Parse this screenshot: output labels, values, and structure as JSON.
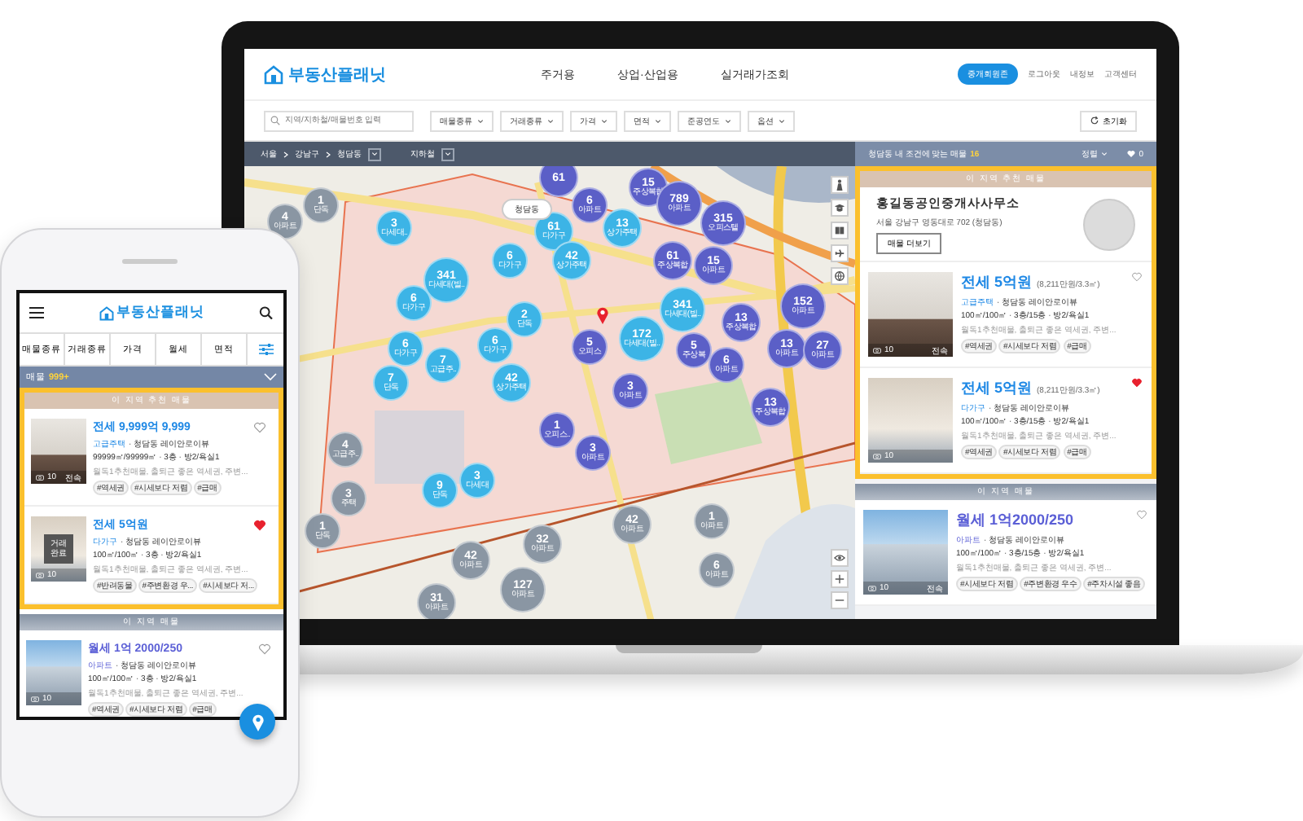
{
  "laptop": {
    "header": {
      "logo": "부동산플래닛",
      "nav": [
        "주거용",
        "상업·산업용",
        "실거래가조회"
      ],
      "member_button": "중개회원존",
      "links": [
        "로그아웃",
        "내정보",
        "고객센터"
      ]
    },
    "filters": {
      "search": {
        "placeholder": "지역/지하철/매물번호 입력"
      },
      "dropdowns": [
        "매물종류",
        "거래종류",
        "가격",
        "면적",
        "준공연도",
        "옵션"
      ],
      "reset_button": "초기화"
    },
    "breadcrumb": {
      "items": [
        "서울",
        "강남구",
        "청담동"
      ],
      "subway": "지하철"
    },
    "map": {
      "area_label": "청담동",
      "clusters": [
        {
          "count": "61",
          "color": "#5b5fc7"
        },
        {
          "count": "15",
          "label": "주상복합",
          "color": "#5b5fc7"
        },
        {
          "count": "4",
          "label": "아파트",
          "color": "#8a96a3"
        },
        {
          "count": "1",
          "label": "단독",
          "color": "#8a96a3"
        },
        {
          "count": "3",
          "label": "다세대..",
          "color": "#3cb4e6"
        },
        {
          "count": "61",
          "label": "다가구",
          "color": "#3cb4e6"
        },
        {
          "count": "6",
          "label": "아파트",
          "color": "#5b5fc7"
        },
        {
          "count": "13",
          "label": "상가주택",
          "color": "#3cb4e6"
        },
        {
          "count": "789",
          "label": "아파트",
          "color": "#5b5fc7"
        },
        {
          "count": "315",
          "label": "오피스텔",
          "color": "#5b5fc7"
        },
        {
          "count": "6",
          "label": "다가구",
          "color": "#3cb4e6"
        },
        {
          "count": "42",
          "label": "상가주택",
          "color": "#3cb4e6"
        },
        {
          "count": "61",
          "label": "주상복합",
          "color": "#5b5fc7"
        },
        {
          "count": "15",
          "label": "아파트",
          "color": "#5b5fc7"
        },
        {
          "count": "6",
          "label": "다가구",
          "color": "#3cb4e6"
        },
        {
          "count": "341",
          "label": "다세대(빌..",
          "color": "#3cb4e6"
        },
        {
          "count": "341",
          "label": "다세대(빌..",
          "color": "#3cb4e6"
        },
        {
          "count": "152",
          "label": "아파트",
          "color": "#5b5fc7"
        },
        {
          "count": "6",
          "label": "다가구",
          "color": "#3cb4e6"
        },
        {
          "count": "7",
          "label": "고급주..",
          "color": "#3cb4e6"
        },
        {
          "count": "6",
          "label": "다가구",
          "color": "#3cb4e6"
        },
        {
          "count": "2",
          "label": "단독",
          "color": "#3cb4e6"
        },
        {
          "count": "5",
          "label": "오피스",
          "color": "#5b5fc7"
        },
        {
          "count": "172",
          "label": "다세대(빌..",
          "color": "#3cb4e6"
        },
        {
          "count": "5",
          "label": "주상복",
          "color": "#5b5fc7"
        },
        {
          "count": "13",
          "label": "주상복합",
          "color": "#5b5fc7"
        },
        {
          "count": "6",
          "label": "아파트",
          "color": "#5b5fc7"
        },
        {
          "count": "13",
          "label": "아파트",
          "color": "#5b5fc7"
        },
        {
          "count": "27",
          "label": "아파트",
          "color": "#5b5fc7"
        },
        {
          "count": "7",
          "label": "단독",
          "color": "#3cb4e6"
        },
        {
          "count": "42",
          "label": "상가주택",
          "color": "#3cb4e6"
        },
        {
          "count": "3",
          "label": "아파트",
          "color": "#5b5fc7"
        },
        {
          "count": "13",
          "label": "주상복합",
          "color": "#5b5fc7"
        },
        {
          "count": "4",
          "label": "고급주..",
          "color": "#8a96a3"
        },
        {
          "count": "1",
          "label": "오피스..",
          "color": "#5b5fc7"
        },
        {
          "count": "3",
          "label": "아파트",
          "color": "#5b5fc7"
        },
        {
          "count": "9",
          "label": "단독",
          "color": "#3cb4e6"
        },
        {
          "count": "3",
          "label": "다세대",
          "color": "#3cb4e6"
        },
        {
          "count": "1",
          "label": "단독",
          "color": "#8a96a3"
        },
        {
          "count": "3",
          "label": "주택",
          "color": "#8a96a3"
        },
        {
          "count": "32",
          "label": "아파트",
          "color": "#8a96a3"
        },
        {
          "count": "42",
          "label": "아파트",
          "color": "#8a96a3"
        },
        {
          "count": "1",
          "label": "아파트",
          "color": "#8a96a3"
        },
        {
          "count": "31",
          "label": "아파트",
          "color": "#8a96a3"
        },
        {
          "count": "42",
          "label": "아파트",
          "color": "#8a96a3"
        },
        {
          "count": "127",
          "label": "아파트",
          "color": "#8a96a3"
        },
        {
          "count": "6",
          "label": "아파트",
          "color": "#8a96a3"
        }
      ]
    },
    "results": {
      "summary": "청담동 내 조건에 맞는 매물",
      "count": "16",
      "sort": "정렬",
      "favorites": "0",
      "recommended": {
        "title": "이 지역 추천 매물",
        "agent": {
          "name": "홍길동공인중개사사무소",
          "address": "서울 강남구 영동대로 702 (청담동)",
          "button": "매물 더보기"
        },
        "listings": [
          {
            "kind": "jeonse",
            "price": "전세 5억원",
            "unit_price": "(8,211만원/3.3㎡)",
            "type": "고급주택",
            "name": "· 청담동 레이안로이뷰",
            "specs": "100㎡/100㎡ · 3층/15층 · 방2/욕실1",
            "description": "월독1추천매물, 출퇴근 좋은 역세권, 주변...",
            "tags": [
              "#역세권",
              "#시세보다 저렴",
              "#급매"
            ],
            "photo_count": "10",
            "badge": "전속",
            "favorite": false
          },
          {
            "kind": "jeonse",
            "price": "전세 5억원",
            "unit_price": "(8,211만원/3.3㎡)",
            "type": "다가구",
            "name": "· 청담동 레이안로이뷰",
            "specs": "100㎡/100㎡ · 3층/15층 · 방2/욕실1",
            "description": "월독1추천매물, 출퇴근 좋은 역세권, 주변...",
            "tags": [
              "#역세권",
              "#시세보다 저렴",
              "#급매"
            ],
            "photo_count": "10",
            "favorite": true
          }
        ]
      },
      "regular": {
        "title": "이 지역 매물",
        "listings": [
          {
            "kind": "wolse",
            "price": "월세 1억2000/250",
            "type": "아파트",
            "name": "· 청담동 레이안로이뷰",
            "specs": "100㎡/100㎡ · 3층/15층 · 방2/욕실1",
            "description": "월독1추천매물, 출퇴근 좋은 역세권, 주변...",
            "tags": [
              "#시세보다 저렴",
              "#주변환경 우수",
              "#주차시설 좋음"
            ],
            "photo_count": "10",
            "badge": "전속",
            "favorite": false
          }
        ]
      }
    }
  },
  "phone": {
    "logo": "부동산플래닛",
    "tabs": [
      "매물종류",
      "거래종류",
      "가격",
      "월세",
      "면적"
    ],
    "count_label": "매물",
    "count": "999+",
    "recommended": {
      "title": "이 지역 추천 매물",
      "listings": [
        {
          "kind": "jeonse",
          "price": "전세 9,999억 9,999",
          "type": "고급주택",
          "name": "· 청담동 레이안로이뷰",
          "specs": "99999㎡/99999㎡ · 3층 · 방2/욕실1",
          "description": "월독1추천매물, 출퇴근 좋은 역세권, 주변...",
          "tags": [
            "#역세권",
            "#시세보다 저렴",
            "#급매"
          ],
          "photo_count": "10",
          "badge": "전속",
          "favorite": false
        },
        {
          "kind": "jeonse",
          "price": "전세 5억원",
          "type": "다가구",
          "name": "· 청담동 레이안로이뷰",
          "specs": "100㎡/100㎡ · 3층 · 방2/욕실1",
          "description": "월독1추천매물, 출퇴근 좋은 역세권, 주변...",
          "tags": [
            "#반려동물",
            "#주변환경 우...",
            "#시세보다 저..."
          ],
          "photo_count": "10",
          "status": "거래완료",
          "favorite": true
        }
      ]
    },
    "regular": {
      "title": "이 지역 매물",
      "listings": [
        {
          "kind": "wolse",
          "price": "월세 1억 2000/250",
          "type": "아파트",
          "name": "· 청담동 레이안로이뷰",
          "specs": "100㎡/100㎡ · 3층 · 방2/욕실1",
          "description": "월독1추천매물, 출퇴근 좋은 역세권, 주변...",
          "tags": [
            "#역세권",
            "#시세보다 저렴",
            "#급매"
          ],
          "photo_count": "10",
          "favorite": false
        }
      ]
    }
  }
}
